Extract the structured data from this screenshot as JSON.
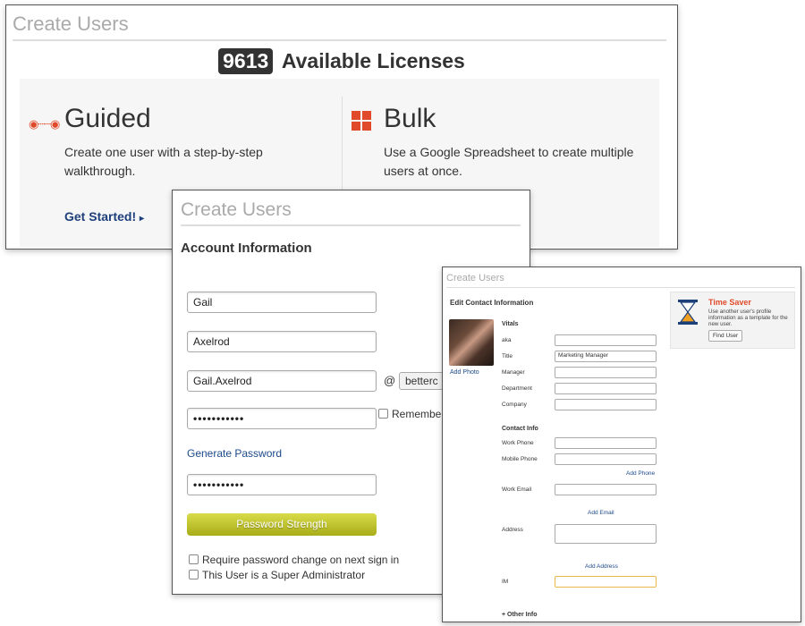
{
  "panel1": {
    "title": "Create Users",
    "license_count": "9613",
    "license_text": "Available Licenses",
    "guided": {
      "title": "Guided",
      "description": "Create one user with a step-by-step walkthrough.",
      "cta": "Get Started!"
    },
    "bulk": {
      "title": "Bulk",
      "description": "Use a Google Spreadsheet to create multiple users at once."
    }
  },
  "panel2": {
    "title": "Create Users",
    "section": "Account Information",
    "first_name": "Gail",
    "last_name": "Axelrod",
    "username": "Gail.Axelrod",
    "at": "@",
    "domain": "betterc",
    "password_mask": "•••••••••••",
    "confirm_mask": "•••••••••••",
    "remember": "Remembe",
    "generate_password": "Generate Password",
    "strength_label": "Password Strength",
    "require_change": "Require password change on next sign in",
    "super_admin": "This User is a Super Administrator"
  },
  "panel3": {
    "title": "Create Users",
    "section": "Edit Contact Information",
    "add_photo": "Add Photo",
    "vitals": "Vitals",
    "aka": "aka",
    "title_label": "Title",
    "title_value": "Marketing Manager",
    "manager": "Manager",
    "department": "Department",
    "company": "Company",
    "contact_info": "Contact Info",
    "work_phone": "Work Phone",
    "mobile_phone": "Mobile Phone",
    "add_phone": "Add Phone",
    "work_email": "Work Email",
    "add_email": "Add Email",
    "address": "Address",
    "add_address": "Add Address",
    "im": "IM",
    "other_info": "+ Other Info",
    "time_saver": {
      "title": "Time Saver",
      "description": "Use another user's profile information as a template for the new user.",
      "button": "Find User"
    }
  },
  "colors": {
    "accent_orange": "#e04a2a",
    "link_blue": "#1d3f7a",
    "strength_green": "#b8bc22"
  }
}
